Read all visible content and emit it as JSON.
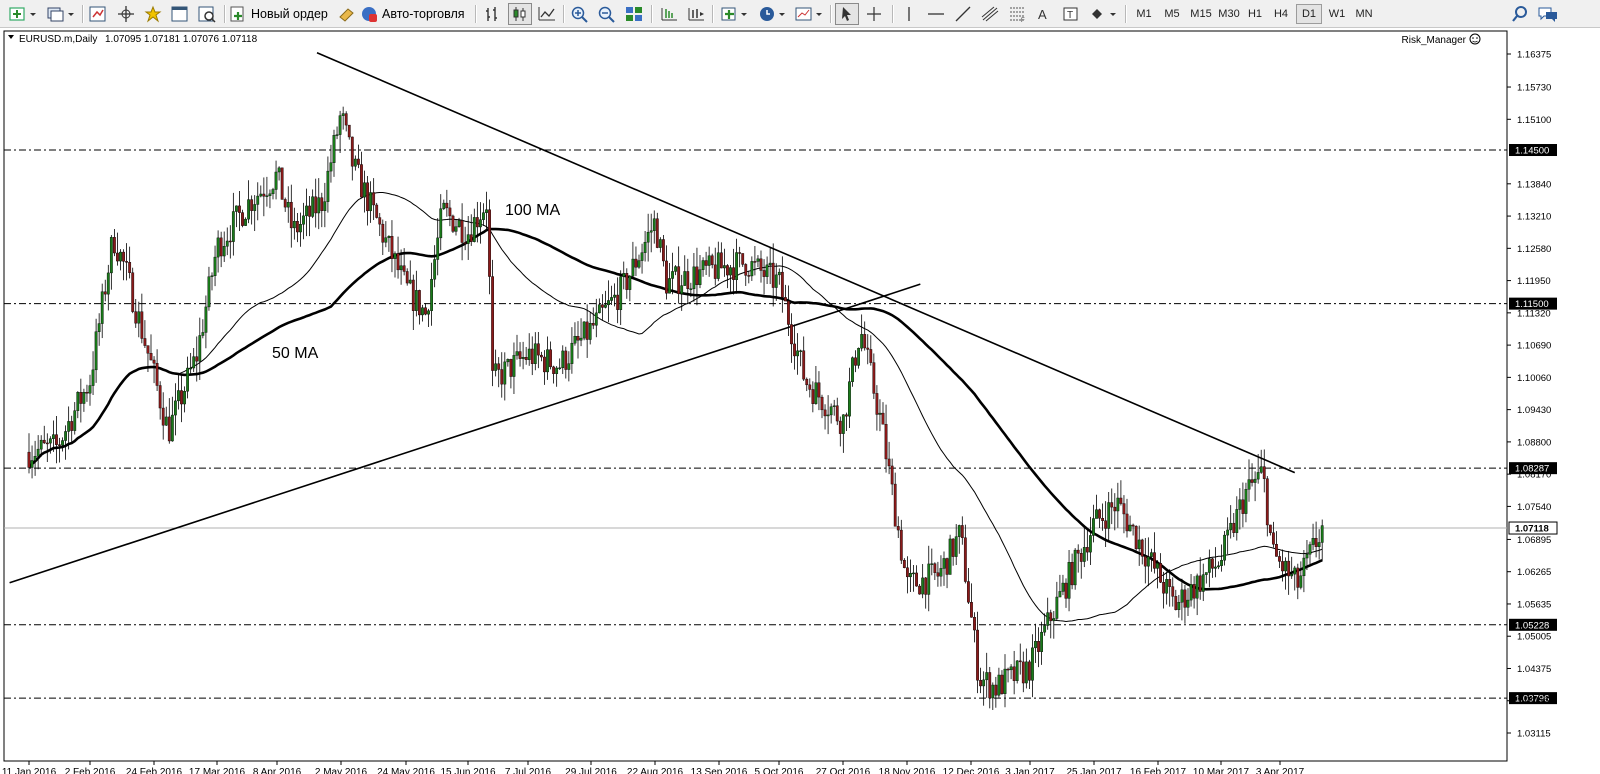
{
  "toolbar": {
    "new_order_label": "Новый ордер",
    "auto_trading_label": "Авто-торговля",
    "timeframes": [
      "M1",
      "M5",
      "M15",
      "M30",
      "H1",
      "H4",
      "D1",
      "W1",
      "MN"
    ],
    "active_timeframe": "D1"
  },
  "chart_header": {
    "symbol": "EURUSD.m,Daily",
    "ohlc": "1.07095 1.07181 1.07076 1.07118",
    "indicator_name": "Risk_Manager"
  },
  "colors": {
    "bull_candle": "#1a7a1a",
    "bear_candle": "#8b1a1a",
    "level_line": "#000000",
    "current_price_bg": "#ffffff"
  },
  "annotations": {
    "ma100": "100 MA",
    "ma50": "50 MA"
  },
  "chart_data": {
    "type": "candlestick",
    "symbol": "EURUSD.m",
    "timeframe": "Daily",
    "ylim": [
      1.028,
      1.171
    ],
    "x_tick_labels": [
      "11 Jan 2016",
      "2 Feb 2016",
      "24 Feb 2016",
      "17 Mar 2016",
      "8 Apr 2016",
      "2 May 2016",
      "24 May 2016",
      "15 Jun 2016",
      "7 Jul 2016",
      "29 Jul 2016",
      "22 Aug 2016",
      "13 Sep 2016",
      "5 Oct 2016",
      "27 Oct 2016",
      "18 Nov 2016",
      "12 Dec 2016",
      "3 Jan 2017",
      "25 Jan 2017",
      "16 Feb 2017",
      "10 Mar 2017",
      "3 Apr 2017"
    ],
    "y_tick_labels": [
      "1.16375",
      "1.15730",
      "1.15100",
      "1.13840",
      "1.13210",
      "1.12580",
      "1.11950",
      "1.11320",
      "1.10690",
      "1.10060",
      "1.09430",
      "1.08800",
      "1.08170",
      "1.07540",
      "1.06895",
      "1.06265",
      "1.05635",
      "1.05005",
      "1.04375",
      "1.03745",
      "1.03115"
    ],
    "horizontal_levels": [
      {
        "price": 1.145,
        "label": "1.14500"
      },
      {
        "price": 1.115,
        "label": "1.11500"
      },
      {
        "price": 1.08287,
        "label": "1.08287"
      },
      {
        "price": 1.05228,
        "label": "1.05228"
      },
      {
        "price": 1.03796,
        "label": "1.03796"
      }
    ],
    "current_price": {
      "price": 1.07118,
      "label": "1.07118"
    },
    "close_path": [
      [
        "11 Jan 2016",
        1.086
      ],
      [
        "21 Jan 2016",
        1.087
      ],
      [
        "2 Feb 2016",
        1.1
      ],
      [
        "10 Feb 2016",
        1.128
      ],
      [
        "14 Feb 2016",
        1.122
      ],
      [
        "24 Feb 2016",
        1.101
      ],
      [
        "29 Feb 2016",
        1.09
      ],
      [
        "10 Mar 2016",
        1.105
      ],
      [
        "17 Mar 2016",
        1.126
      ],
      [
        "29 Mar 2016",
        1.135
      ],
      [
        "8 Apr 2016",
        1.14
      ],
      [
        "14 Apr 2016",
        1.129
      ],
      [
        "25 Apr 2016",
        1.135
      ],
      [
        "2 May 2016",
        1.152
      ],
      [
        "6 May 2016",
        1.142
      ],
      [
        "24 May 2016",
        1.118
      ],
      [
        "31 May 2016",
        1.113
      ],
      [
        "6 Jun 2016",
        1.133
      ],
      [
        "15 Jun 2016",
        1.129
      ],
      [
        "22 Jun 2016",
        1.135
      ],
      [
        "24 Jun 2016",
        1.1
      ],
      [
        "7 Jul 2016",
        1.105
      ],
      [
        "18 Jul 2016",
        1.103
      ],
      [
        "29 Jul 2016",
        1.11
      ],
      [
        "10 Aug 2016",
        1.118
      ],
      [
        "22 Aug 2016",
        1.131
      ],
      [
        "26 Aug 2016",
        1.119
      ],
      [
        "13 Sep 2016",
        1.122
      ],
      [
        "23 Sep 2016",
        1.123
      ],
      [
        "5 Oct 2016",
        1.119
      ],
      [
        "14 Oct 2016",
        1.1
      ],
      [
        "27 Oct 2016",
        1.092
      ],
      [
        "2 Nov 2016",
        1.11
      ],
      [
        "9 Nov 2016",
        1.092
      ],
      [
        "18 Nov 2016",
        1.06
      ],
      [
        "30 Nov 2016",
        1.062
      ],
      [
        "8 Dec 2016",
        1.07
      ],
      [
        "15 Dec 2016",
        1.042
      ],
      [
        "21 Dec 2016",
        1.04
      ],
      [
        "3 Jan 2017",
        1.044
      ],
      [
        "11 Jan 2017",
        1.055
      ],
      [
        "25 Jan 2017",
        1.072
      ],
      [
        "2 Feb 2017",
        1.076
      ],
      [
        "16 Feb 2017",
        1.062
      ],
      [
        "22 Feb 2017",
        1.056
      ],
      [
        "10 Mar 2017",
        1.065
      ],
      [
        "20 Mar 2017",
        1.078
      ],
      [
        "27 Mar 2017",
        1.082
      ],
      [
        "31 Mar 2017",
        1.066
      ],
      [
        "10 Apr 2017",
        1.06
      ],
      [
        "21 Apr 2017",
        1.072
      ]
    ]
  }
}
